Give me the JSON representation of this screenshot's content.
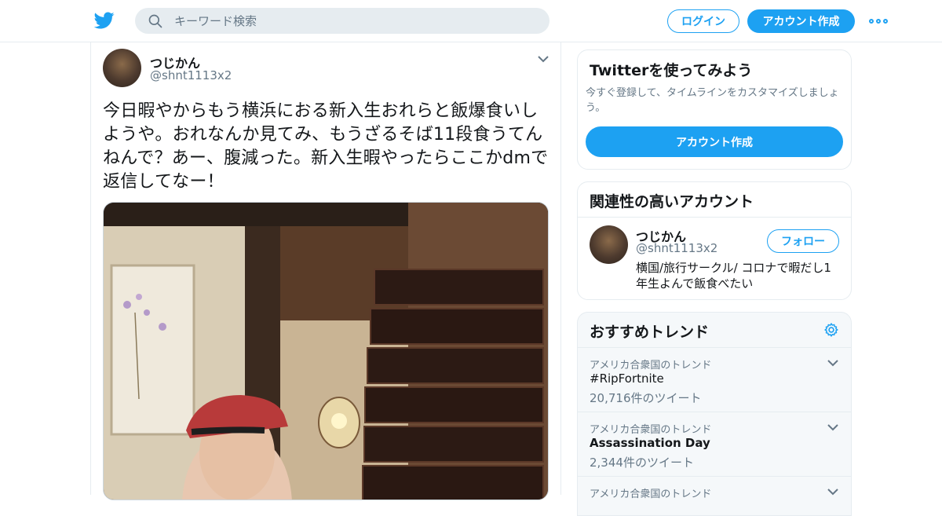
{
  "header": {
    "search_placeholder": "キーワード検索",
    "login_label": "ログイン",
    "signup_label": "アカウント作成"
  },
  "tweet": {
    "name": "つじかん",
    "handle": "@shnt1113x2",
    "text": "今日暇やからもう横浜におる新入生おれらと飯爆食いしようや。おれなんか見てみ、もうざるそば11段食うてんねんで？あー、腹減った。新入生暇やったらここかdmで返信してなー！"
  },
  "signup_card": {
    "title": "Twitterを使ってみよう",
    "description": "今すぐ登録して、タイムラインをカスタマイズしましょう。",
    "button_label": "アカウント作成"
  },
  "related_card": {
    "title": "関連性の高いアカウント",
    "account": {
      "name": "つじかん",
      "handle": "@shnt1113x2",
      "bio": "横国/旅行サークル/ コロナで暇だし1年生よんで飯食べたい",
      "follow_label": "フォロー"
    }
  },
  "trends_card": {
    "title": "おすすめトレンド",
    "items": [
      {
        "context": "アメリカ合衆国のトレンド",
        "title": "#RipFortnite",
        "count": "20,716件のツイート"
      },
      {
        "context": "アメリカ合衆国のトレンド",
        "title": "Assassination Day",
        "count": "2,344件のツイート"
      },
      {
        "context": "アメリカ合衆国のトレンド",
        "title": "",
        "count": ""
      }
    ]
  },
  "colors": {
    "accent": "#1da1f2",
    "secondary_text": "#657786",
    "border": "#e6ecf0"
  },
  "icons": [
    "twitter-bird-icon",
    "search-icon",
    "more-dots-icon",
    "chevron-down-icon",
    "gear-icon"
  ]
}
